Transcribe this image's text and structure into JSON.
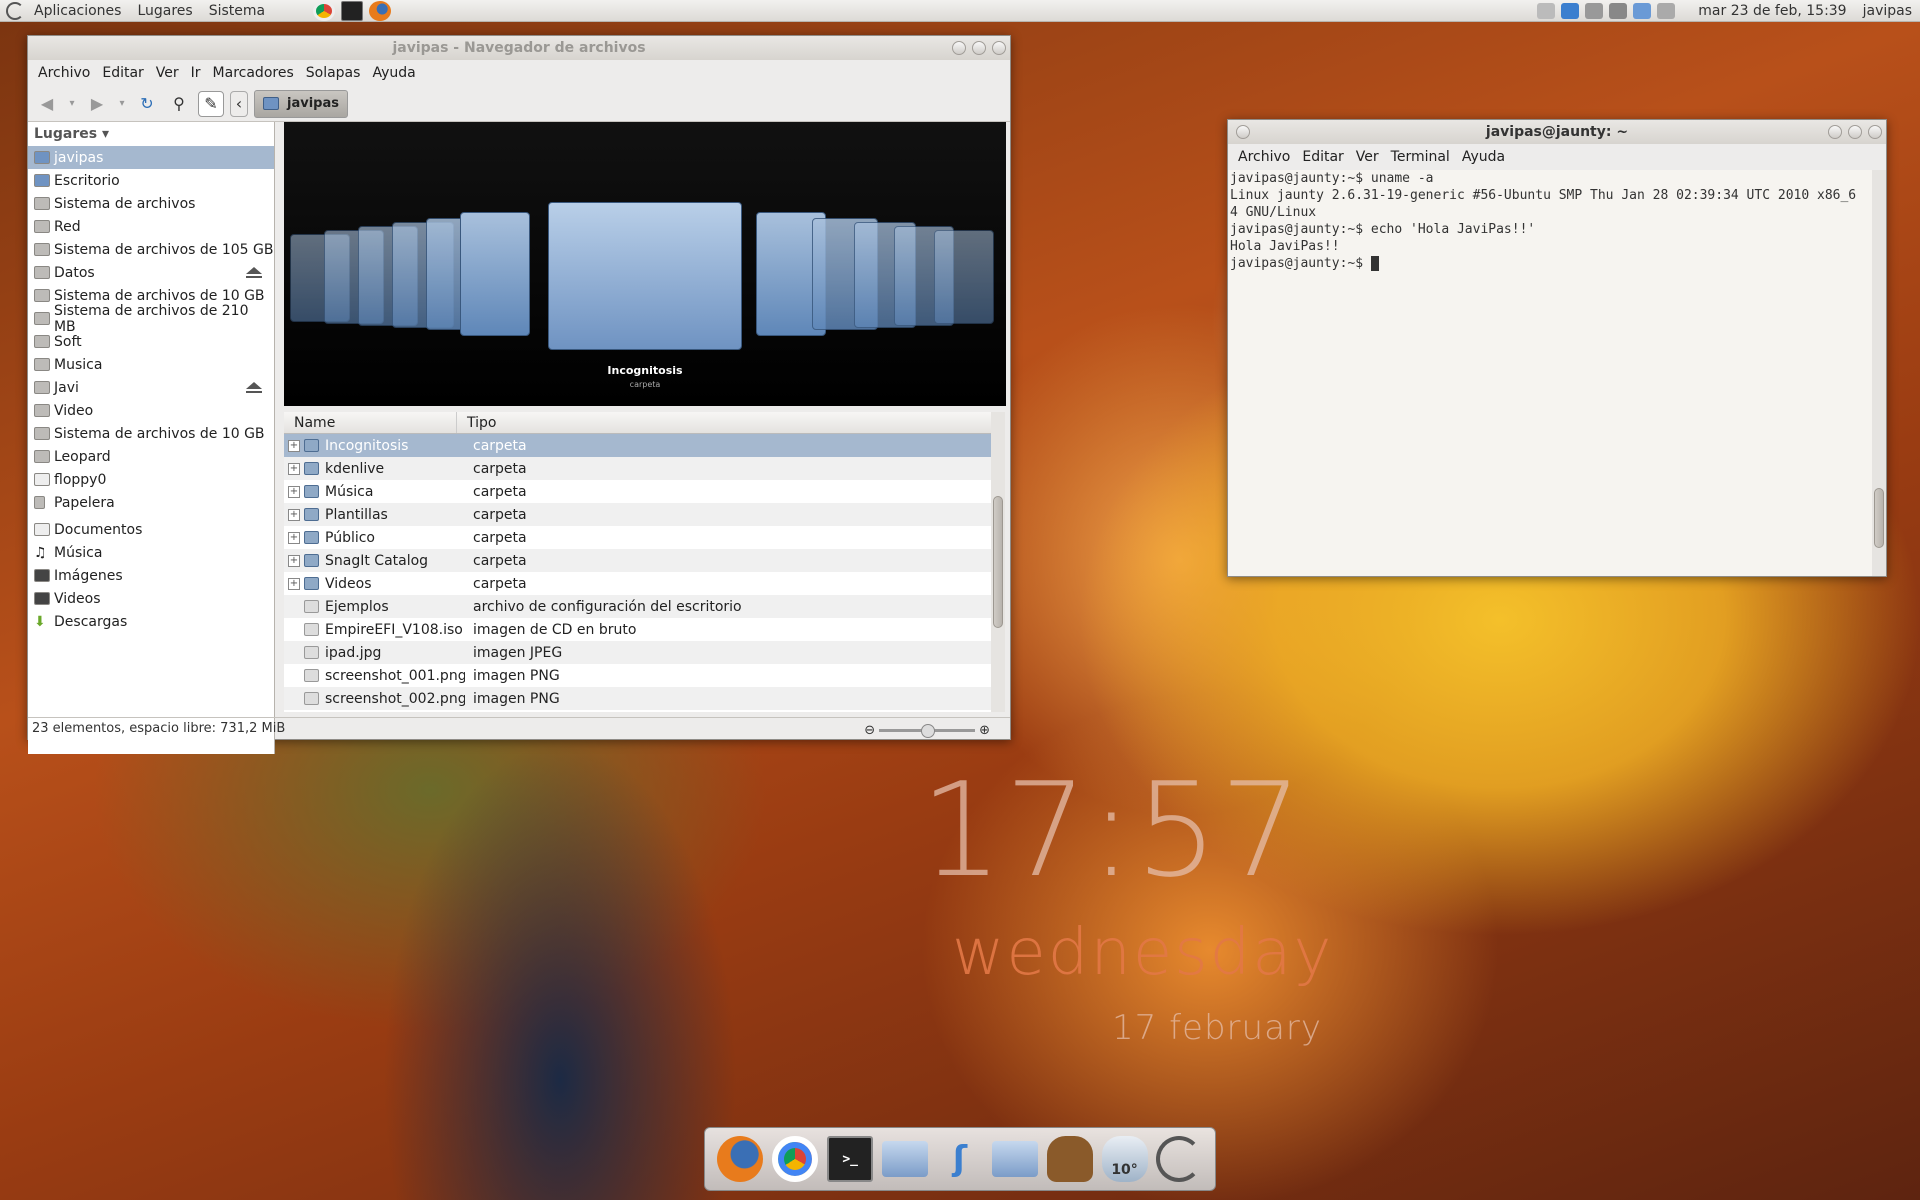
{
  "panel": {
    "menus": [
      "Aplicaciones",
      "Lugares",
      "Sistema"
    ],
    "datetime": "mar 23 de feb, 15:39",
    "user": "javipas"
  },
  "filemanager": {
    "title": "javipas - Navegador de archivos",
    "menus": [
      "Archivo",
      "Editar",
      "Ver",
      "Ir",
      "Marcadores",
      "Solapas",
      "Ayuda"
    ],
    "crumb": "javipas",
    "sidebar_header": "Lugares",
    "places": [
      "javipas",
      "Escritorio",
      "Sistema de archivos",
      "Red",
      "Sistema de archivos de 105 GB",
      "Datos",
      "Sistema de archivos de 10 GB",
      "Sistema de archivos de 210 MB",
      "Soft",
      "Musica",
      "Javi",
      "Video",
      "Sistema de archivos de 10 GB",
      "Leopard",
      "floppy0",
      "Papelera"
    ],
    "bookmarks": [
      "Documentos",
      "Música",
      "Imágenes",
      "Videos",
      "Descargas"
    ],
    "coverflow": {
      "label": "Incognitosis",
      "sublabel": "carpeta"
    },
    "columns": [
      "Name",
      "Tipo"
    ],
    "rows": [
      {
        "name": "Incognitosis",
        "type": "carpeta"
      },
      {
        "name": "kdenlive",
        "type": "carpeta"
      },
      {
        "name": "Música",
        "type": "carpeta"
      },
      {
        "name": "Plantillas",
        "type": "carpeta"
      },
      {
        "name": "Público",
        "type": "carpeta"
      },
      {
        "name": "SnagIt Catalog",
        "type": "carpeta"
      },
      {
        "name": "Videos",
        "type": "carpeta"
      },
      {
        "name": "Ejemplos",
        "type": "archivo de configuración del escritorio"
      },
      {
        "name": "EmpireEFI_V108.iso",
        "type": "imagen de CD en bruto"
      },
      {
        "name": "ipad.jpg",
        "type": "imagen JPEG"
      },
      {
        "name": "screenshot_001.png",
        "type": "imagen PNG"
      },
      {
        "name": "screenshot_002.png",
        "type": "imagen PNG"
      }
    ],
    "status": "23 elementos, espacio libre: 731,2 MiB"
  },
  "terminal": {
    "title": "javipas@jaunty: ~",
    "menus": [
      "Archivo",
      "Editar",
      "Ver",
      "Terminal",
      "Ayuda"
    ],
    "lines": [
      "javipas@jaunty:~$ uname -a",
      "Linux jaunty 2.6.31-19-generic #56-Ubuntu SMP Thu Jan 28 02:39:34 UTC 2010 x86_6",
      "4 GNU/Linux",
      "javipas@jaunty:~$ echo 'Hola JaviPas!!'",
      "Hola JaviPas!!",
      "javipas@jaunty:~$ "
    ]
  },
  "clock": {
    "time": "17:57",
    "day": "wednesday",
    "date": "17 february"
  },
  "dock": {
    "weather": "10°"
  },
  "colors": {
    "selection": "#a5b8cf",
    "folder": "#6f93c2"
  }
}
